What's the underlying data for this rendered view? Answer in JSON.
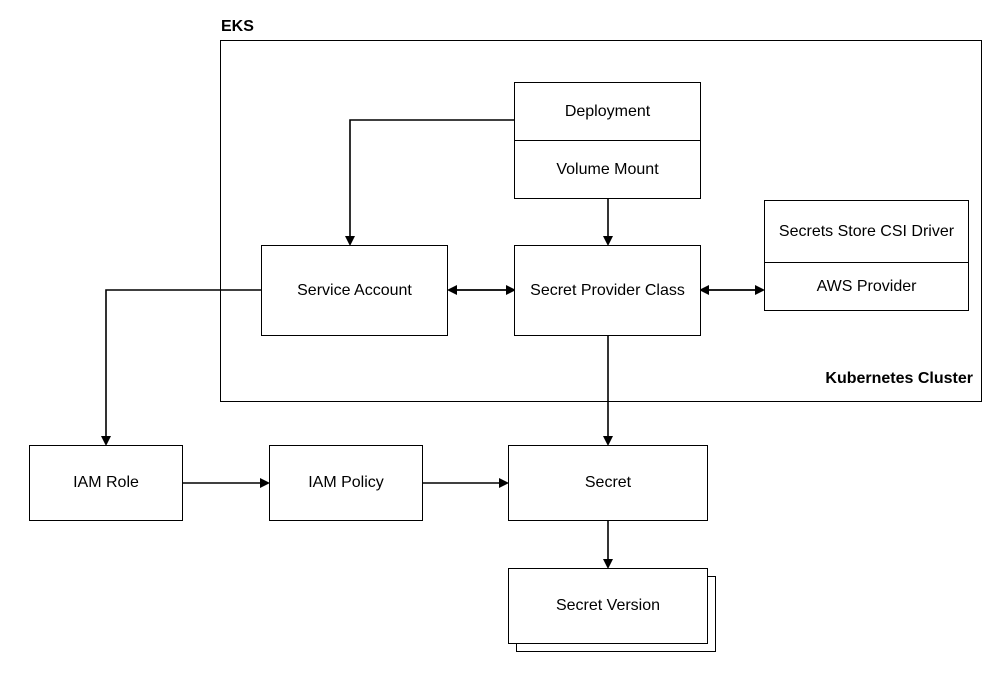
{
  "labels": {
    "eks": "EKS",
    "k8s_cluster": "Kubernetes Cluster"
  },
  "nodes": {
    "deployment": "Deployment",
    "volume_mount": "Volume Mount",
    "service_account": "Service Account",
    "secret_provider_class": "Secret Provider Class",
    "csi_driver": "Secrets Store CSI Driver",
    "aws_provider": "AWS Provider",
    "iam_role": "IAM Role",
    "iam_policy": "IAM Policy",
    "secret": "Secret",
    "secret_version": "Secret Version"
  }
}
